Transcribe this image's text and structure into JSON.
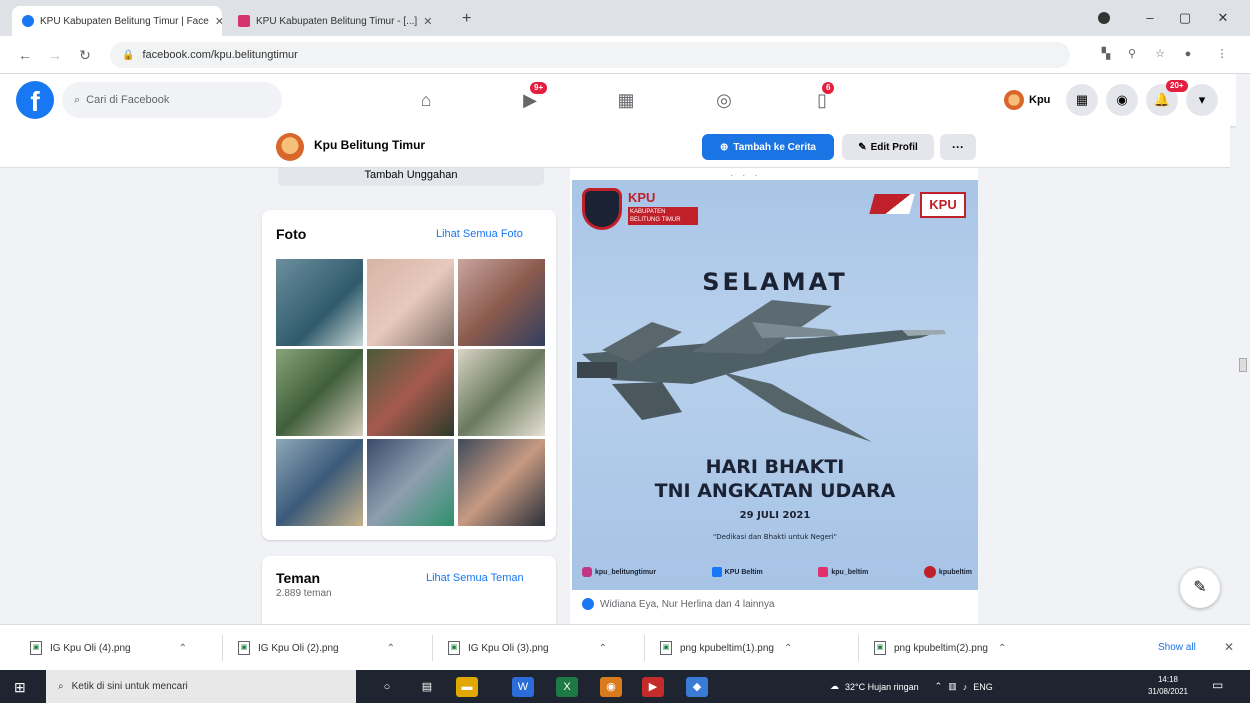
{
  "browser": {
    "tabs": [
      {
        "title": "KPU Kabupaten Belitung Timur | Face",
        "favicon_color": "#1877f2",
        "active": true
      },
      {
        "title": "KPU Kabupaten Belitung Timur - [...]",
        "favicon_color": "#d6336c",
        "active": false
      }
    ],
    "new_tab": "+",
    "url": "facebook.com/kpu.belitungtimur",
    "window": {
      "minimize": "–",
      "maximize": "▢",
      "close": "✕"
    }
  },
  "facebook": {
    "logo": "f",
    "search_placeholder": "Cari di Facebook",
    "nav_badges": {
      "watch": "9+",
      "groups": "6"
    },
    "account_name": "Kpu",
    "notif_badge": "20+",
    "brand_color": "#1877f2"
  },
  "profile": {
    "name": "Kpu Belitung Timur",
    "add_story": "Tambah ke Cerita",
    "edit_profile": "Edit Profil",
    "more": "···",
    "intro_button": "Tambah Unggahan"
  },
  "photos": {
    "title": "Foto",
    "see_all": "Lihat Semua Foto"
  },
  "friends": {
    "title": "Teman",
    "see_all": "Lihat Semua Teman",
    "count": "2.889 teman"
  },
  "post": {
    "kpu_logo": "KPU",
    "kpu_sub": "KABUPATEN BELITUNG TIMUR",
    "kpu_brand_right": "KPU",
    "greeting": "SELAMAT",
    "headline1": "HARI BHAKTI",
    "headline2": "TNI ANGKATAN UDARA",
    "date": "29 JULI 2021",
    "message": "\"Dedikasi dan Bhakti untuk Negeri\"",
    "socials": [
      "kpu_belitungtimur",
      "KPU Beltim",
      "kpu_beltim",
      "kpubeltim"
    ],
    "reactions_text": "Widiana Eya, Nur Herlina dan 4 lainnya"
  },
  "downloads": {
    "items": [
      "IG Kpu Oli (4).png",
      "IG Kpu Oli (2).png",
      "IG Kpu Oli (3).png",
      "png kpubeltim(1).png",
      "png kpubeltim(2).png"
    ],
    "show_all": "Show all",
    "close": "✕"
  },
  "taskbar": {
    "search_placeholder": "Ketik di sini untuk mencari",
    "weather": "32°C Hujan ringan",
    "language": "ENG",
    "time": "14:18",
    "date": "31/08/2021"
  }
}
